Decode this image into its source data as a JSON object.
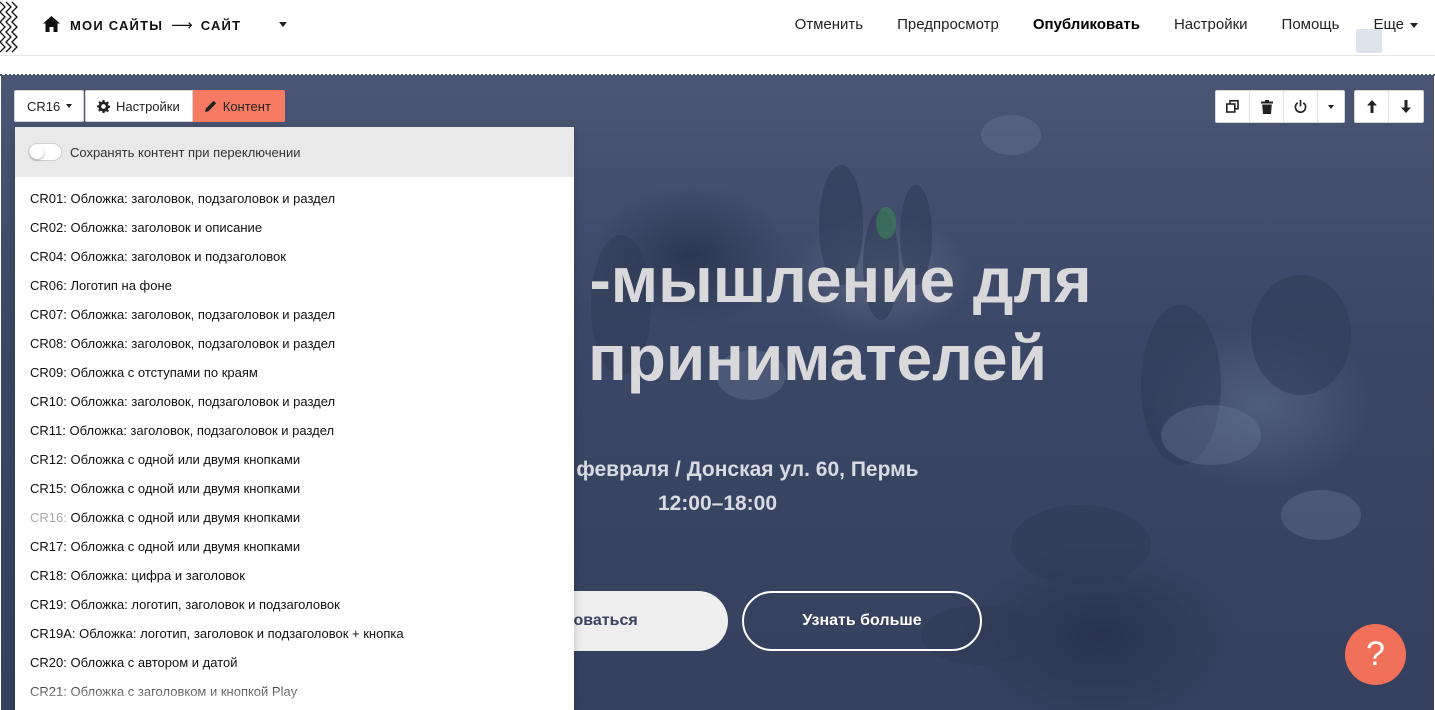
{
  "topbar": {
    "breadcrumb_root": "МОИ САЙТЫ",
    "breadcrumb_sep": "⟶",
    "breadcrumb_current": "САЙТ",
    "menu": {
      "undo": "Отменить",
      "preview": "Предпросмотр",
      "publish": "Опубликовать",
      "settings": "Настройки",
      "help": "Помощь",
      "more": "Еще"
    }
  },
  "block_toolbar": {
    "block_code": "CR16",
    "settings_label": "Настройки",
    "content_label": "Контент"
  },
  "panel": {
    "keep_content_label": "Сохранять контент при переключении",
    "current_code": "CR16:",
    "items": [
      {
        "code": "CR01:",
        "title": "Обложка: заголовок, подзаголовок и раздел"
      },
      {
        "code": "CR02:",
        "title": "Обложка: заголовок и описание"
      },
      {
        "code": "CR04:",
        "title": "Обложка: заголовок и подзаголовок"
      },
      {
        "code": "CR06:",
        "title": "Логотип на фоне"
      },
      {
        "code": "CR07:",
        "title": "Обложка: заголовок, подзаголовок и раздел"
      },
      {
        "code": "CR08:",
        "title": "Обложка: заголовок, подзаголовок и раздел"
      },
      {
        "code": "CR09:",
        "title": "Обложка с отступами по краям"
      },
      {
        "code": "CR10:",
        "title": "Обложка: заголовок, подзаголовок и раздел"
      },
      {
        "code": "CR11:",
        "title": "Обложка: заголовок, подзаголовок и раздел"
      },
      {
        "code": "CR12:",
        "title": "Обложка с одной или двумя кнопками"
      },
      {
        "code": "CR15:",
        "title": "Обложка с одной или двумя кнопками"
      },
      {
        "code": "CR16:",
        "title": "Обложка с одной или двумя кнопками"
      },
      {
        "code": "CR17:",
        "title": "Обложка с одной или двумя кнопками"
      },
      {
        "code": "CR18:",
        "title": "Обложка: цифра и заголовок"
      },
      {
        "code": "CR19:",
        "title": "Обложка: логотип, заголовок и подзаголовок"
      },
      {
        "code": "CR19A:",
        "title": "Обложка: логотип, заголовок и подзаголовок + кнопка"
      },
      {
        "code": "CR20:",
        "title": "Обложка с автором и датой"
      },
      {
        "code": "CR21:",
        "title": "Обложка с заголовком и кнопкой Play"
      }
    ]
  },
  "hero": {
    "title_line1": "-мышление для",
    "title_line2": "принимателей",
    "subtitle_line1": "февраля / Донская ул. 60, Пермь",
    "subtitle_line2": "12:00–18:00",
    "primary_button": "трироваться",
    "secondary_button": "Узнать больше",
    "help_button": "?"
  },
  "colors": {
    "accent": "#f77b62",
    "hero_overlay": "#3b4766",
    "help_button": "#f0705a"
  },
  "icons": {
    "home": "home-icon",
    "gear": "gear-icon",
    "pencil": "pencil-icon",
    "copy": "copy-icon",
    "trash": "trash-icon",
    "power": "power-icon",
    "arrow_up": "arrow-up-icon",
    "arrow_down": "arrow-down-icon"
  }
}
